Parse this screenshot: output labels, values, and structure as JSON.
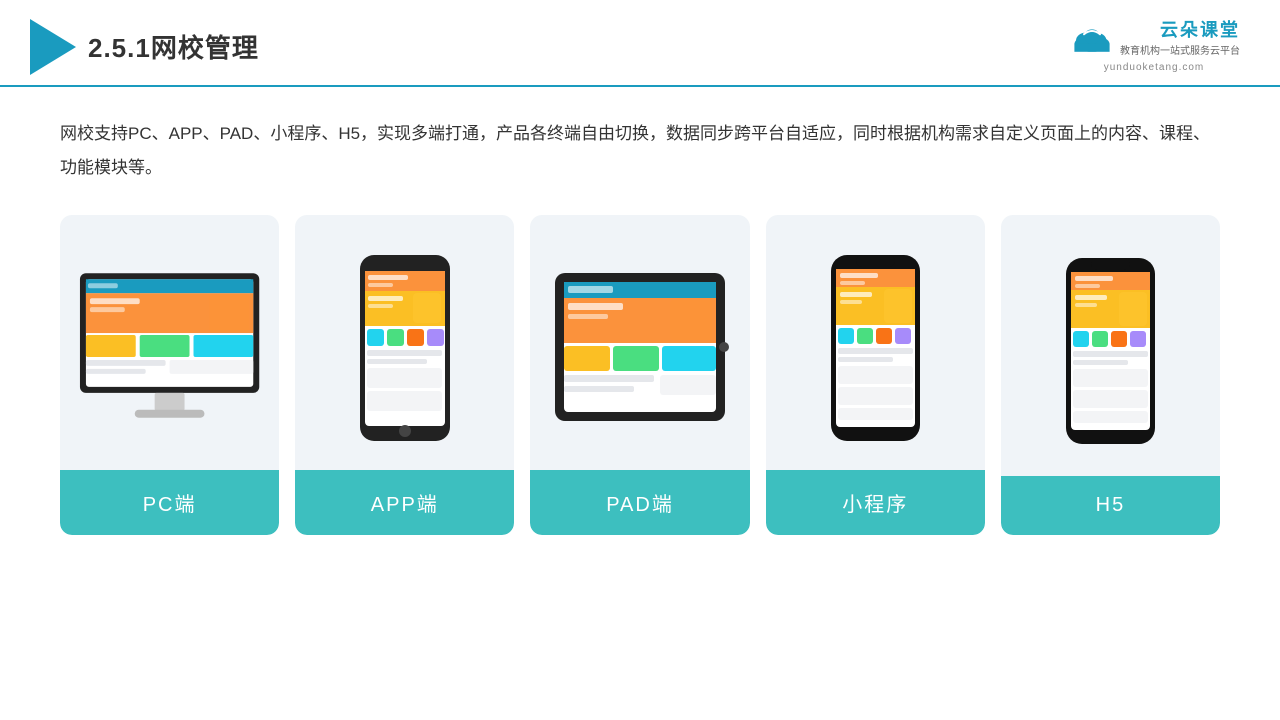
{
  "header": {
    "title": "2.5.1网校管理",
    "brand": {
      "name": "云朵课堂",
      "domain": "yunduoketang.com",
      "tagline_line1": "教育机构一站",
      "tagline_line2": "式服务云平台"
    }
  },
  "description": "网校支持PC、APP、PAD、小程序、H5，实现多端打通，产品各终端自由切换，数据同步跨平台自适应，同时根据机构需求自定义页面上的内容、课程、功能模块等。",
  "cards": [
    {
      "id": "pc",
      "label": "PC端"
    },
    {
      "id": "app",
      "label": "APP端"
    },
    {
      "id": "pad",
      "label": "PAD端"
    },
    {
      "id": "mini",
      "label": "小程序"
    },
    {
      "id": "h5",
      "label": "H5"
    }
  ]
}
